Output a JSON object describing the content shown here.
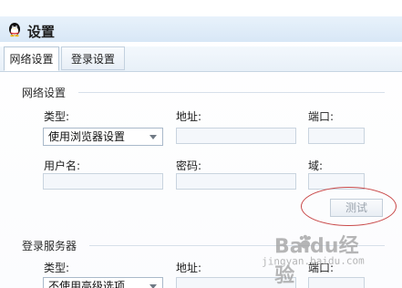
{
  "window": {
    "title": "设置"
  },
  "tabs": [
    {
      "label": "网络设置",
      "active": true
    },
    {
      "label": "登录设置",
      "active": false
    }
  ],
  "network_section": {
    "title": "网络设置",
    "type_label": "类型:",
    "type_value": "使用浏览器设置",
    "address_label": "地址:",
    "address_value": "",
    "port_label": "端口:",
    "port_value": "",
    "username_label": "用户名:",
    "username_value": "",
    "password_label": "密码:",
    "password_value": "",
    "domain_label": "域:",
    "domain_value": "",
    "test_button_label": "测试"
  },
  "login_server_section": {
    "title": "登录服务器",
    "type_label": "类型:",
    "type_value": "不使用高级选项",
    "address_label": "地址:",
    "address_value": "",
    "port_label": "端口:",
    "port_value": ""
  },
  "watermark": {
    "main": "Baidu经验",
    "sub": "jingyan.baidu.com"
  },
  "colors": {
    "titlebar": "#dfeaf7",
    "highlight": "#c94a4a",
    "disabled_text": "#9aa3ad"
  },
  "icons": [
    "qq-penguin-icon",
    "dropdown-arrow-icon",
    "baidu-paw-icon"
  ]
}
